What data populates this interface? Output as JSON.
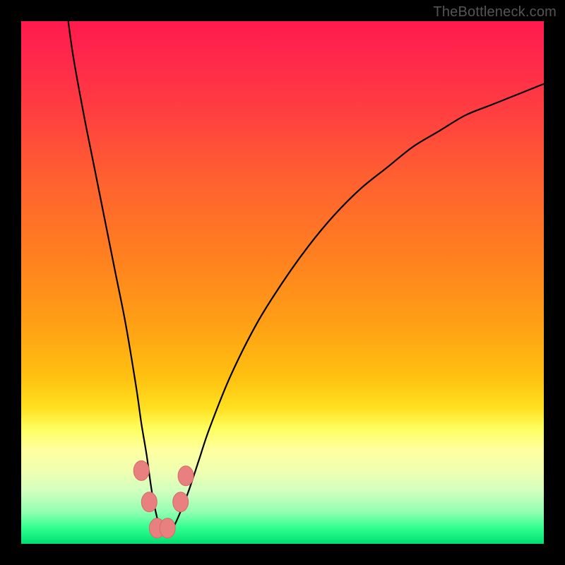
{
  "watermark": "TheBottleneck.com",
  "colors": {
    "background": "#000000",
    "curve_stroke": "#000000",
    "marker_fill": "#e88080",
    "marker_stroke": "#d86868"
  },
  "chart_data": {
    "type": "line",
    "title": "",
    "xlabel": "",
    "ylabel": "",
    "xlim": [
      0,
      100
    ],
    "ylim": [
      0,
      100
    ],
    "grid": false,
    "legend": false,
    "series": [
      {
        "name": "curve",
        "x": [
          9,
          10,
          12,
          14,
          16,
          18,
          20,
          22,
          23,
          24,
          25,
          26,
          27,
          28,
          29,
          30,
          32,
          34,
          36,
          40,
          45,
          50,
          55,
          60,
          65,
          70,
          75,
          80,
          85,
          90,
          95,
          100
        ],
        "values": [
          100,
          93,
          82,
          72,
          62,
          52,
          42,
          30,
          23,
          17,
          10,
          5,
          2,
          2,
          3,
          5,
          10,
          16,
          22,
          32,
          42,
          50,
          57,
          63,
          68,
          72,
          76,
          79,
          82,
          84,
          86,
          88
        ]
      }
    ],
    "markers": [
      {
        "x": 23.0,
        "y": 14.0
      },
      {
        "x": 24.5,
        "y": 8.0
      },
      {
        "x": 26.0,
        "y": 3.0
      },
      {
        "x": 28.0,
        "y": 3.0
      },
      {
        "x": 30.5,
        "y": 8.0
      },
      {
        "x": 31.5,
        "y": 13.0
      }
    ]
  }
}
